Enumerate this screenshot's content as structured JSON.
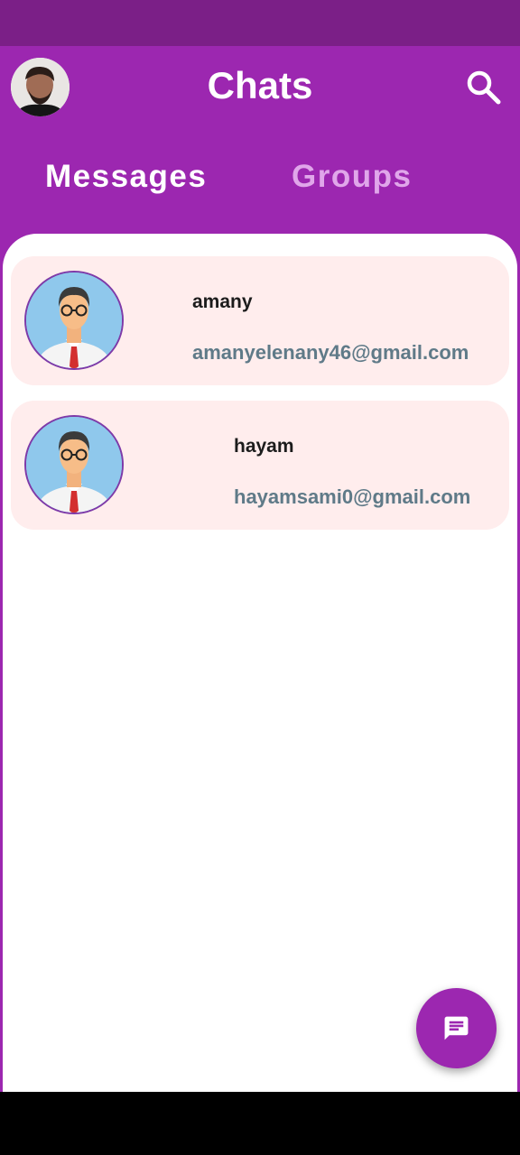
{
  "app": {
    "title": "Chats",
    "colors": {
      "primary": "#9c27b0",
      "status_bar": "#7b1f87",
      "card_bg": "#ffeded",
      "email_text": "#5f7a88",
      "inactive_tab": "#e0a6ea"
    }
  },
  "header": {
    "profile_avatar_icon": "user-photo-avatar",
    "search_icon": "search-icon"
  },
  "tabs": [
    {
      "label": "Messages",
      "active": true
    },
    {
      "label": "Groups",
      "active": false
    }
  ],
  "chats": [
    {
      "name": "amany",
      "email": "amanyelenany46@gmail.com",
      "avatar_icon": "man-with-glasses-avatar"
    },
    {
      "name": "hayam",
      "email": "hayamsami0@gmail.com",
      "avatar_icon": "man-with-glasses-avatar"
    }
  ],
  "fab": {
    "icon": "message-icon"
  }
}
